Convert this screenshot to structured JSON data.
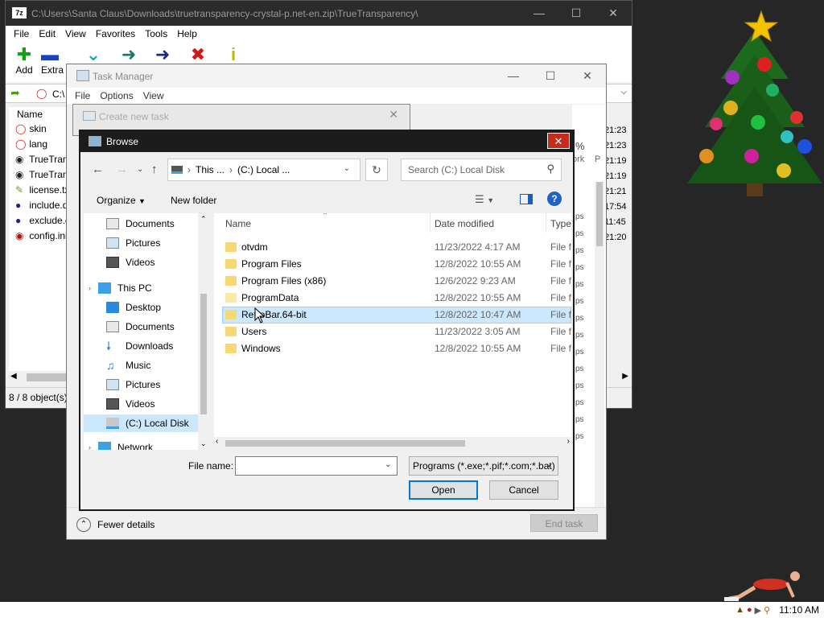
{
  "zip": {
    "title": "C:\\Users\\Santa Claus\\Downloads\\truetransparency-crystal-p.net-en.zip\\TrueTransparency\\",
    "app_icon": "7z",
    "menu": [
      "File",
      "Edit",
      "View",
      "Favorites",
      "Tools",
      "Help"
    ],
    "toolbar": {
      "add": "Add",
      "extract": "Extra"
    },
    "address": "C:\\",
    "list_header": "Name",
    "files": [
      {
        "name": "skin",
        "icon": "ring-icon",
        "time": "21:23"
      },
      {
        "name": "lang",
        "icon": "ring-icon",
        "time": "21:23"
      },
      {
        "name": "TrueTrans",
        "icon": "app-icon",
        "time": "21:19"
      },
      {
        "name": "TrueTrans",
        "icon": "app-icon",
        "time": "21:19"
      },
      {
        "name": "license.txt",
        "icon": "text-icon",
        "time": "21:21"
      },
      {
        "name": "include.d",
        "icon": "purple-icon",
        "time": "17:54"
      },
      {
        "name": "exclude.d",
        "icon": "purple-icon",
        "time": "11:45"
      },
      {
        "name": "config.ini",
        "icon": "ini-icon",
        "time": "21:20"
      }
    ],
    "status": "8 / 8 object(s)"
  },
  "taskmgr": {
    "title": "Task Manager",
    "menu": [
      "File",
      "Options",
      "View"
    ],
    "side": {
      "percent": "%",
      "col_a": "ork",
      "col_b": "P",
      "rows": [
        "ps",
        "ps",
        "ps",
        "ps",
        "ps",
        "ps",
        "ps",
        "ps",
        "ps",
        "ps",
        "ps",
        "ps",
        "ps",
        "ps"
      ]
    },
    "fewer_details": "Fewer details",
    "end_task": "End task"
  },
  "create_task": {
    "title": "Create new task"
  },
  "browse": {
    "title": "Browse",
    "path": [
      "This ...",
      "(C:) Local ..."
    ],
    "search_placeholder": "Search (C:) Local Disk",
    "organize": "Organize",
    "new_folder": "New folder",
    "nav": [
      {
        "label": "Documents",
        "pinned": true
      },
      {
        "label": "Pictures",
        "pinned": true
      },
      {
        "label": "Videos",
        "pinned": true
      },
      {
        "label": "This PC",
        "pinned": false
      },
      {
        "label": "Desktop",
        "pinned": false
      },
      {
        "label": "Documents",
        "pinned": false
      },
      {
        "label": "Downloads",
        "pinned": false
      },
      {
        "label": "Music",
        "pinned": false
      },
      {
        "label": "Pictures",
        "pinned": false
      },
      {
        "label": "Videos",
        "pinned": false
      },
      {
        "label": "(C:) Local Disk",
        "pinned": false
      },
      {
        "label": "Network",
        "pinned": false
      }
    ],
    "columns": {
      "name": "Name",
      "date": "Date modified",
      "type": "Type"
    },
    "rows": [
      {
        "name": "otvdm",
        "date": "11/23/2022 4:17 AM",
        "type": "File fo"
      },
      {
        "name": "Program Files",
        "date": "12/8/2022 10:55 AM",
        "type": "File fo"
      },
      {
        "name": "Program Files (x86)",
        "date": "12/6/2022 9:23 AM",
        "type": "File fo"
      },
      {
        "name": "ProgramData",
        "date": "12/8/2022 10:55 AM",
        "type": "File fo"
      },
      {
        "name": "RetroBar.64-bit",
        "date": "12/8/2022 10:47 AM",
        "type": "File fo"
      },
      {
        "name": "Users",
        "date": "11/23/2022 3:05 AM",
        "type": "File fo"
      },
      {
        "name": "Windows",
        "date": "12/8/2022 10:55 AM",
        "type": "File fo"
      }
    ],
    "file_name_label": "File name:",
    "file_name_value": "",
    "filter": "Programs (*.exe;*.pif;*.com;*.bat)",
    "open": "Open",
    "cancel": "Cancel"
  },
  "taskbar": {
    "clock": "11:10 AM"
  }
}
